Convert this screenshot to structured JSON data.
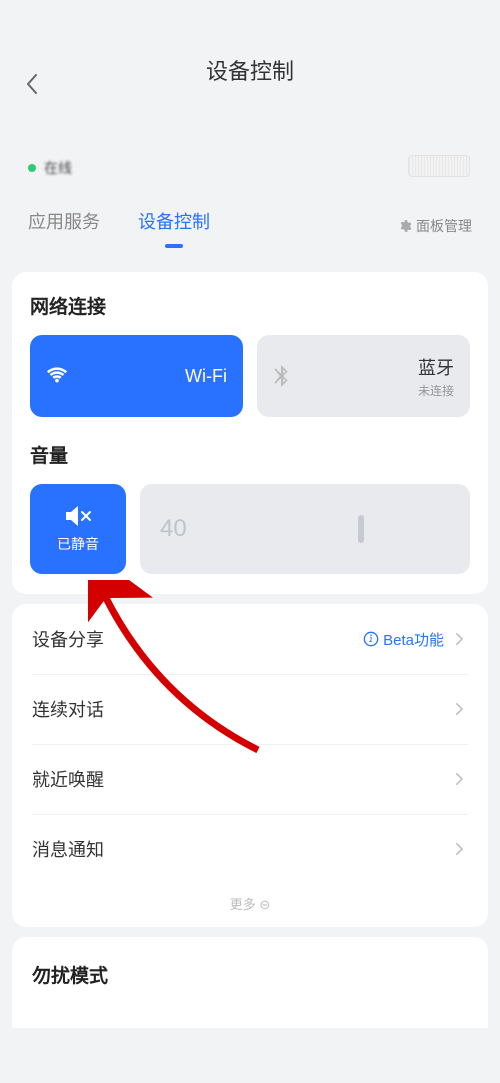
{
  "header": {
    "title": "设备控制"
  },
  "status": {
    "online": "在线"
  },
  "tabs": {
    "items": [
      {
        "label": "应用服务",
        "active": false
      },
      {
        "label": "设备控制",
        "active": true
      }
    ],
    "panel_mgmt": "面板管理"
  },
  "network": {
    "title": "网络连接",
    "wifi": {
      "label": "Wi-Fi"
    },
    "bt": {
      "label": "蓝牙",
      "sub": "未连接"
    }
  },
  "volume": {
    "title": "音量",
    "mute_label": "已静音",
    "value": "40"
  },
  "list": {
    "share": {
      "label": "设备分享",
      "badge": "Beta功能"
    },
    "cont_dialog": {
      "label": "连续对话"
    },
    "nearby_wake": {
      "label": "就近唤醒"
    },
    "msg_notify": {
      "label": "消息通知"
    },
    "more": "更多"
  },
  "dnd": {
    "title": "勿扰模式"
  }
}
